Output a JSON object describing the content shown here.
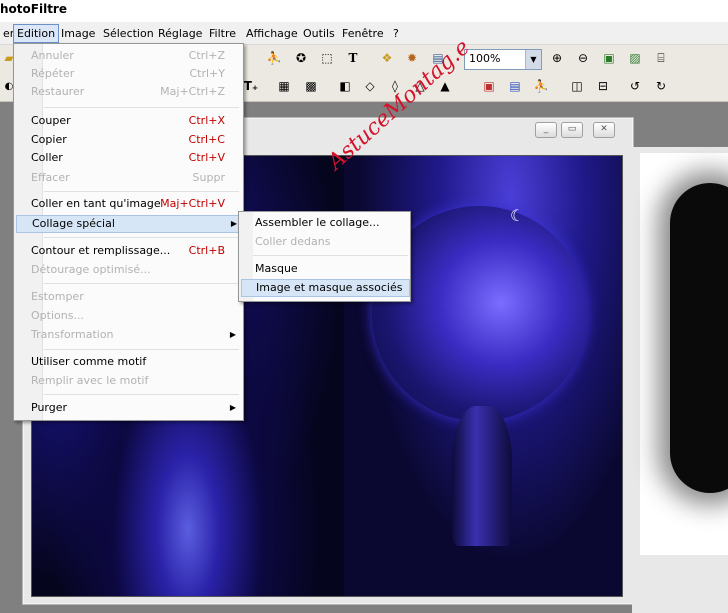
{
  "app": {
    "title": "hotoFiltre"
  },
  "menubar": {
    "items": [
      "er",
      "Edition",
      "Image",
      "Sélection",
      "Réglage",
      "Filtre",
      "Affichage",
      "Outils",
      "Fenêtre",
      "?"
    ],
    "active": "Edition"
  },
  "toolbar": {
    "zoom_value": "100%"
  },
  "edit_menu": {
    "items": [
      {
        "label": "Annuler",
        "shortcut": "Ctrl+Z",
        "enabled": false
      },
      {
        "label": "Répéter",
        "shortcut": "Ctrl+Y",
        "enabled": false
      },
      {
        "label": "Restaurer",
        "shortcut": "Maj+Ctrl+Z",
        "enabled": false
      },
      {
        "label": "Couper",
        "shortcut": "Ctrl+X",
        "enabled": true
      },
      {
        "label": "Copier",
        "shortcut": "Ctrl+C",
        "enabled": true
      },
      {
        "label": "Coller",
        "shortcut": "Ctrl+V",
        "enabled": true
      },
      {
        "label": "Effacer",
        "shortcut": "Suppr",
        "enabled": false
      },
      {
        "label": "Coller en tant qu'image",
        "shortcut": "Maj+Ctrl+V",
        "enabled": true
      },
      {
        "label": "Collage spécial",
        "shortcut": "",
        "enabled": true,
        "submenu": true,
        "highlighted": true
      },
      {
        "label": "Contour et remplissage...",
        "shortcut": "Ctrl+B",
        "enabled": true
      },
      {
        "label": "Détourage optimisé...",
        "shortcut": "",
        "enabled": false
      },
      {
        "label": "Estomper",
        "shortcut": "",
        "enabled": false
      },
      {
        "label": "Options...",
        "shortcut": "",
        "enabled": false
      },
      {
        "label": "Transformation",
        "shortcut": "",
        "enabled": false,
        "submenu": true
      },
      {
        "label": "Utiliser comme motif",
        "shortcut": "",
        "enabled": true
      },
      {
        "label": "Remplir avec le motif",
        "shortcut": "",
        "enabled": false
      },
      {
        "label": "Purger",
        "shortcut": "",
        "enabled": true,
        "submenu": true
      }
    ]
  },
  "paste_special_submenu": {
    "items": [
      {
        "label": "Assembler le collage...",
        "enabled": true
      },
      {
        "label": "Coller dedans",
        "enabled": false
      },
      {
        "label": "Masque",
        "enabled": true
      },
      {
        "label": "Image et masque associés",
        "enabled": true,
        "highlighted": true
      }
    ]
  },
  "watermark": {
    "text": "AstuceMontag.e"
  },
  "colors": {
    "menu_highlight": "#d7e6f6",
    "shortcut_red": "#c00000",
    "canvas_blue": "#2a22a8"
  }
}
